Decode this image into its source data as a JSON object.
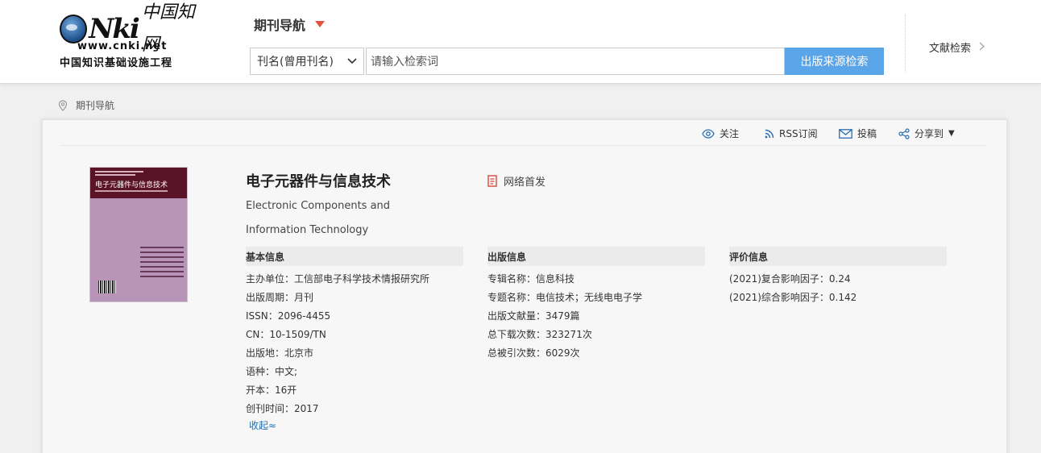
{
  "logo": {
    "nki_text": "Nki",
    "cn_text": "中国知网",
    "url_text": "www.cnki.net",
    "subtitle": "中国知识基础设施工程"
  },
  "header": {
    "nav_title": "期刊导航",
    "search_field_select": "刊名(曾用刊名)",
    "search_placeholder": "请输入检索词",
    "search_button": "出版来源检索",
    "lit_search": "文献检索"
  },
  "breadcrumb": {
    "label": "期刊导航"
  },
  "toolbar": {
    "follow": "关注",
    "rss": "RSS订阅",
    "submit": "投稿",
    "share": "分享到"
  },
  "journal": {
    "title_cn": "电子元器件与信息技术",
    "title_en": "Electronic Components and Information Technology",
    "first_publish": "网络首发",
    "cover_title": "电子元器件与信息技术"
  },
  "sections": {
    "basic": {
      "heading": "基本信息",
      "rows": [
        {
          "label": "主办单位：",
          "value": "工信部电子科学技术情报研究所"
        },
        {
          "label": "出版周期：",
          "value": "月刊"
        },
        {
          "label": "ISSN：",
          "value": "2096-4455"
        },
        {
          "label": "CN：",
          "value": "10-1509/TN"
        },
        {
          "label": "出版地：",
          "value": "北京市"
        },
        {
          "label": "语种：",
          "value": "中文;"
        },
        {
          "label": "开本：",
          "value": "16开"
        },
        {
          "label": "创刊时间：",
          "value": "2017"
        }
      ],
      "collapse": "收起≈"
    },
    "publish": {
      "heading": "出版信息",
      "rows": [
        {
          "label": "专辑名称：",
          "value": "信息科技"
        },
        {
          "label": "专题名称：",
          "value": "电信技术；无线电电子学"
        },
        {
          "label": "出版文献量：",
          "value": "3479篇"
        },
        {
          "label": "总下载次数：",
          "value": "323271次"
        },
        {
          "label": "总被引次数：",
          "value": "6029次"
        }
      ]
    },
    "evaluation": {
      "heading": "评价信息",
      "rows": [
        {
          "label": "(2021)复合影响因子：",
          "value": "0.24"
        },
        {
          "label": "(2021)综合影响因子：",
          "value": "0.142"
        }
      ]
    }
  },
  "colors": {
    "accent_blue": "#5aa5e8",
    "caret_red": "#e2533e",
    "link_blue": "#1e6fb8",
    "cover_pink": "#b894b8",
    "cover_maroon": "#5a1428"
  }
}
